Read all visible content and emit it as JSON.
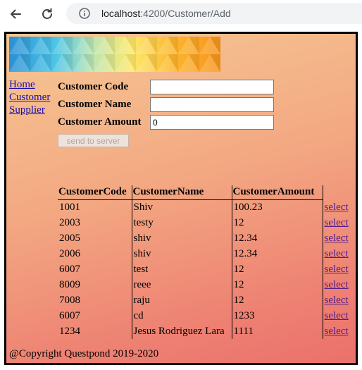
{
  "browser": {
    "url_host": "localhost",
    "url_path": ":4200/Customer/Add"
  },
  "sidebar": {
    "links": [
      "Home",
      "Customer",
      "Supplier"
    ]
  },
  "form": {
    "fields": [
      {
        "label": "Customer Code",
        "value": ""
      },
      {
        "label": "Customer Name",
        "value": ""
      },
      {
        "label": "Customer Amount",
        "value": "0"
      }
    ],
    "submit_label": "send to server"
  },
  "table": {
    "headers": [
      "CustomerCode",
      "CustomerName",
      "CustomerAmount"
    ],
    "rows": [
      {
        "code": "1001",
        "name": "Shiv",
        "amount": "100.23",
        "action": "select"
      },
      {
        "code": "2003",
        "name": "testy",
        "amount": "12",
        "action": "select"
      },
      {
        "code": "2005",
        "name": "shiv",
        "amount": "12.34",
        "action": "select"
      },
      {
        "code": "2006",
        "name": "shiv",
        "amount": "12.34",
        "action": "select"
      },
      {
        "code": "6007",
        "name": "test",
        "amount": "12",
        "action": "select"
      },
      {
        "code": "8009",
        "name": "reee",
        "amount": "12",
        "action": "select"
      },
      {
        "code": "7008",
        "name": "raju",
        "amount": "12",
        "action": "select"
      },
      {
        "code": "6007",
        "name": "cd",
        "amount": "1233",
        "action": "select"
      },
      {
        "code": "1234",
        "name": "Jesus Rodriguez Lara",
        "amount": "1111",
        "action": "select"
      }
    ]
  },
  "footer": "@Copyright Questpond 2019-2020",
  "colors": {
    "link": "#1a0dab",
    "visited_link": "#551a8b",
    "background_top": "#f6c793",
    "background_bottom": "#eb716c"
  }
}
